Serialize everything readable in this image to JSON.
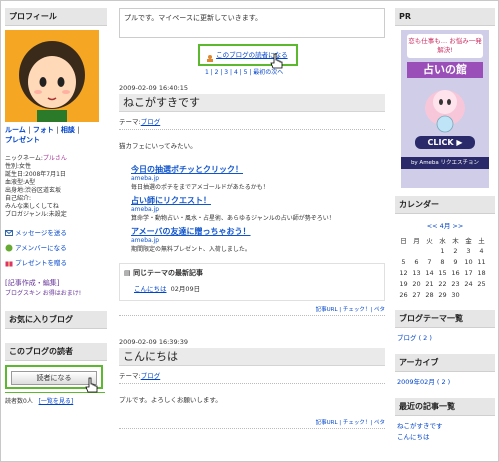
{
  "left": {
    "profile_header": "プロフィール",
    "nav_links": [
      "ルーム",
      "フォト",
      "相談",
      "プレゼント"
    ],
    "profile_lines": [
      "ニックネーム:",
      "プルさん",
      "性別:女性",
      "誕生日:2008年7月1日",
      "血液型:A型",
      "出身地:渋谷区道玄坂",
      "自己紹介:",
      "みんな楽しくしてね",
      "ブロガジャンル:未設定"
    ],
    "links": [
      "メッセージを送る",
      "アメンバーになる",
      "プレゼントを贈る"
    ],
    "edit_title": "[記事作成・編集]",
    "edit_sub": "ブログスキン お得はおまけ!",
    "favorites_header": "お気に入りブログ",
    "readers_header": "このブログの読者",
    "reader_button": "読者になる",
    "reader_count_label": "読者数0人",
    "reader_list_link": "[一覧を見る]"
  },
  "center": {
    "message": "プルです。マイペースに更新していきます。",
    "reader_link": "このブログの読者になる",
    "pager": "1 | 2 | 3 | 4 | 5 | 最初の次へ",
    "entries": [
      {
        "date": "2009-02-09 16:40:15",
        "title": "ねこがすきです",
        "theme_label": "テーマ:",
        "theme": "ブログ",
        "body": "猫カフェにいってみたい。",
        "promos": [
          {
            "title": "今日の抽選ポチッとクリック！",
            "src": "ameba.jp",
            "desc": "毎日抽選のポチをまでアメゴールドがあたるかも！"
          },
          {
            "title": "占い師にリクエスト！",
            "src": "ameba.jp",
            "desc": "算命学・動物占い・風水・占星術、あらゆるジャンルの占い師が勢ぞろい！"
          },
          {
            "title": "アメーバの友達に贈っちゃおう！",
            "src": "ameba.jp",
            "desc": "期間限定の無料プレゼント、入荷しました。"
          }
        ],
        "same_theme_header": "同じテーマの最新記事",
        "same_theme_item": "こんにちは",
        "same_theme_date": "02月09日",
        "actions": "記事URL | チェック！| ペタ"
      },
      {
        "date": "2009-02-09 16:39:39",
        "title": "こんにちは",
        "theme_label": "テーマ:",
        "theme": "ブログ",
        "body": "プルです。よろしくお願いします。",
        "actions": "記事URL | チェック！| ペタ"
      }
    ]
  },
  "right": {
    "pr_header": "PR",
    "ad_top": "恋も仕事も… お悩み一発解決!",
    "ad_title": "占いの館",
    "ad_click": "CLICK ▶",
    "ad_brand": "by Ameba リクエスチョン",
    "calendar_header": "カレンダー",
    "calendar_month": "<< 4月 >>",
    "weekdays": [
      "日",
      "月",
      "火",
      "水",
      "木",
      "金",
      "土"
    ],
    "weeks": [
      [
        "",
        "",
        "",
        "1",
        "2",
        "3",
        "4"
      ],
      [
        "5",
        "6",
        "7",
        "8",
        "9",
        "10",
        "11"
      ],
      [
        "12",
        "13",
        "14",
        "15",
        "16",
        "17",
        "18"
      ],
      [
        "19",
        "20",
        "21",
        "22",
        "23",
        "24",
        "25"
      ],
      [
        "26",
        "27",
        "28",
        "29",
        "30",
        "",
        ""
      ]
    ],
    "theme_header": "ブログテーマ一覧",
    "theme_link": "ブログ ( 2 )",
    "archive_header": "アーカイブ",
    "archive_link": "2009年02月 ( 2 )",
    "recent_header": "最近の記事一覧",
    "recent_link": "ねこがすきです",
    "recent_link2": "こんにちは"
  }
}
